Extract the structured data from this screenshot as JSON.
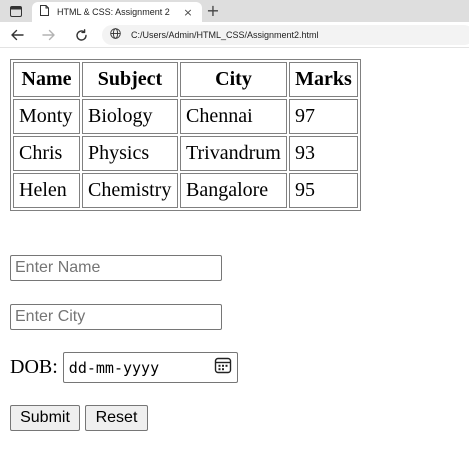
{
  "browser": {
    "tab_title": "HTML & CSS: Assignment 2",
    "close_glyph": "×",
    "new_tab_glyph": "+",
    "url": "C:/Users/Admin/HTML_CSS/Assignment2.html"
  },
  "table": {
    "headers": [
      "Name",
      "Subject",
      "City",
      "Marks"
    ],
    "rows": [
      [
        "Monty",
        "Biology",
        "Chennai",
        "97"
      ],
      [
        "Chris",
        "Physics",
        "Trivandrum",
        "93"
      ],
      [
        "Helen",
        "Chemistry",
        "Bangalore",
        "95"
      ]
    ]
  },
  "form": {
    "name_placeholder": "Enter Name",
    "city_placeholder": "Enter City",
    "dob_label": "DOB:",
    "dob_placeholder": "dd-mm-yyyy",
    "submit_label": "Submit",
    "reset_label": "Reset"
  }
}
